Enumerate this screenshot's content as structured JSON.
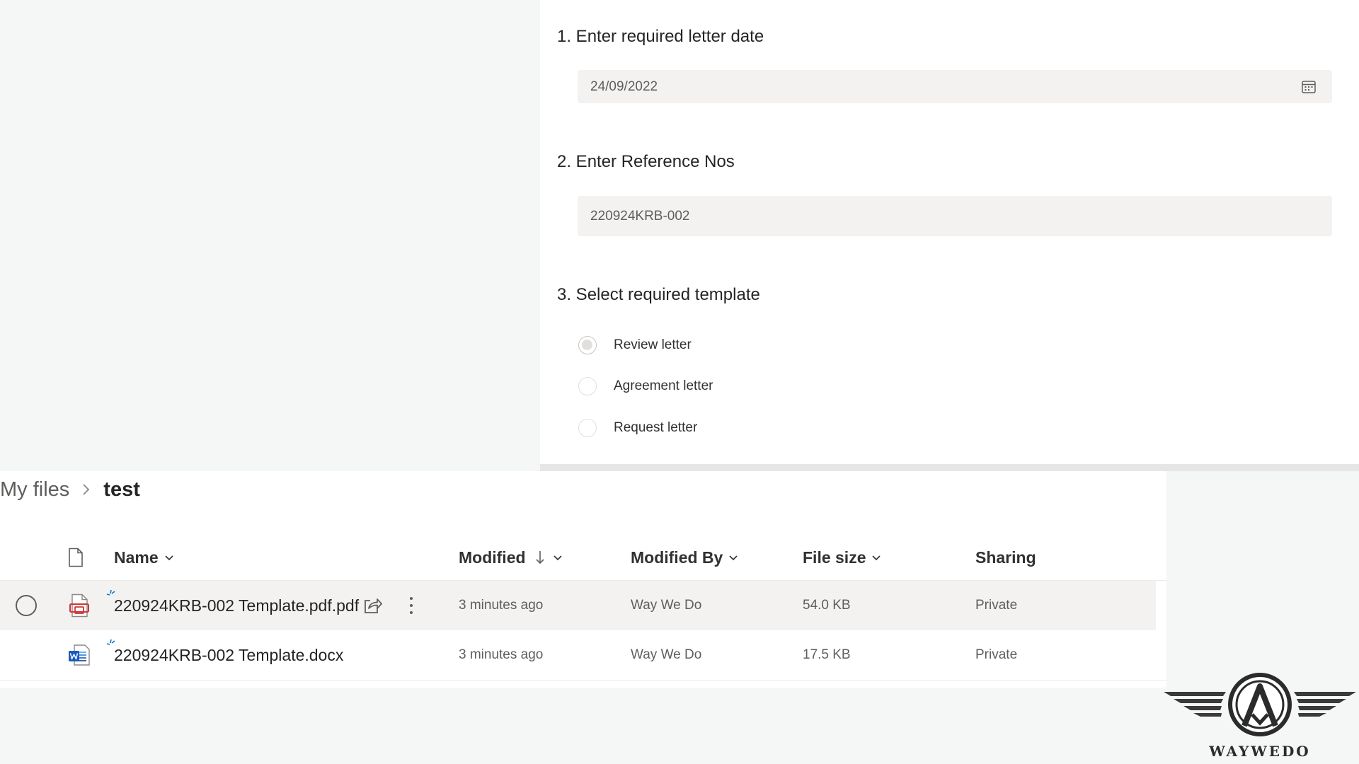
{
  "form": {
    "q1": {
      "label": "1. Enter required letter date",
      "value": "24/09/2022"
    },
    "q2": {
      "label": "2. Enter Reference Nos",
      "value": "220924KRB-002"
    },
    "q3": {
      "label": "3. Select required template",
      "options": [
        {
          "label": "Review letter",
          "selected": true
        },
        {
          "label": "Agreement letter",
          "selected": false
        },
        {
          "label": "Request letter",
          "selected": false
        }
      ]
    }
  },
  "files": {
    "breadcrumb": {
      "root": "My files",
      "current": "test"
    },
    "columns": {
      "name": "Name",
      "modified": "Modified",
      "modified_by": "Modified By",
      "file_size": "File size",
      "sharing": "Sharing"
    },
    "rows": [
      {
        "name": "220924KRB-002 Template.pdf.pdf",
        "icon": "pdf-file-icon",
        "modified": "3 minutes ago",
        "modified_by": "Way We Do",
        "file_size": "54.0 KB",
        "sharing": "Private"
      },
      {
        "name": "220924KRB-002 Template.docx",
        "icon": "word-file-icon",
        "modified": "3 minutes ago",
        "modified_by": "Way We Do",
        "file_size": "17.5 KB",
        "sharing": "Private"
      }
    ]
  },
  "logo": {
    "text": "WAYWEDO"
  },
  "colors": {
    "pdf_red": "#d13438",
    "word_blue": "#185abd",
    "new_spark": "#0078d4"
  }
}
